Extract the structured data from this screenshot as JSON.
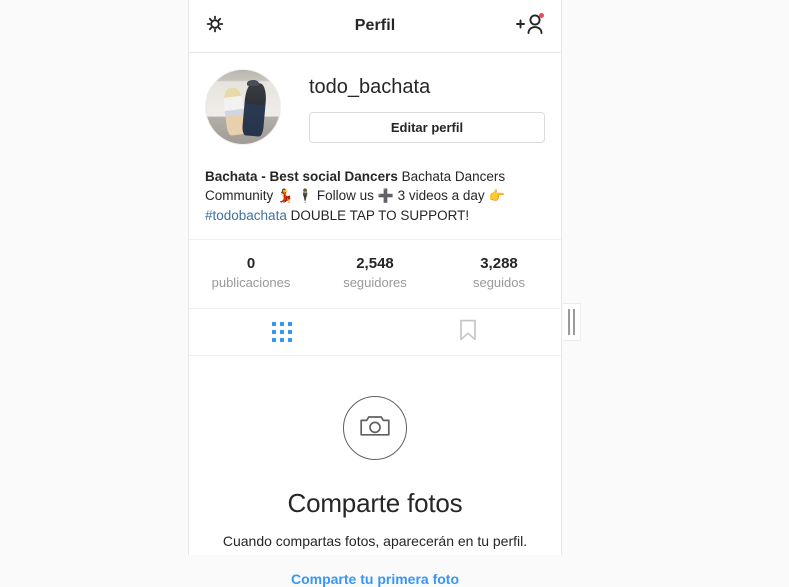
{
  "header": {
    "title": "Perfil",
    "settings_icon": "gear-icon",
    "add_person_icon": "add-person-icon",
    "has_notification_badge": true,
    "badge_color": "#ed4956"
  },
  "profile": {
    "username": "todo_bachata",
    "edit_button_label": "Editar perfil",
    "avatar_alt": "profile-photo-two-dancers",
    "bio": {
      "name": "Bachata - Best social Dancers",
      "text_1": " Bachata Dancers Community ",
      "emoji_1": "💃",
      "emoji_2": "🕴",
      "text_2": " Follow us ",
      "emoji_3": "➕",
      "text_3": " 3 videos a day ",
      "emoji_4": "👉",
      "hashtag": "#todobachata",
      "text_4": " DOUBLE TAP TO SUPPORT!"
    }
  },
  "stats": [
    {
      "value": "0",
      "label": "publicaciones"
    },
    {
      "value": "2,548",
      "label": "seguidores"
    },
    {
      "value": "3,288",
      "label": "seguidos"
    }
  ],
  "tabs": [
    {
      "name": "grid",
      "icon": "grid-icon",
      "active": true,
      "color": "#3897f0"
    },
    {
      "name": "saved",
      "icon": "bookmark-icon",
      "active": false,
      "color": "#c7c7c7"
    }
  ],
  "empty_state": {
    "icon": "camera-icon",
    "title": "Comparte fotos",
    "description": "Cuando compartas fotos, aparecerán en tu perfil.",
    "link_label": "Comparte tu primera foto",
    "link_color": "#3897f0"
  },
  "resize_handle": {
    "name": "panel-resize-handle"
  }
}
